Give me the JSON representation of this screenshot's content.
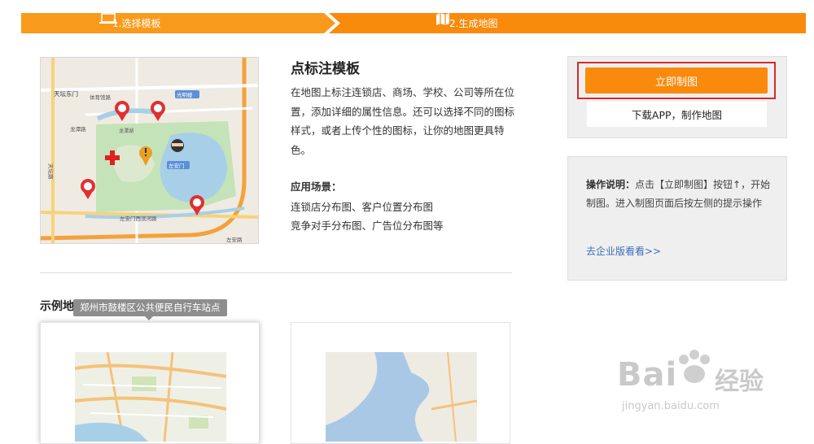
{
  "steps": [
    {
      "label": "1.选择模板",
      "icon": "laptop-icon"
    },
    {
      "label": "2.生成地图",
      "icon": "map-icon"
    }
  ],
  "colors": {
    "accent": "#fa8a0c",
    "highlight": "#d62b2b",
    "link": "#3b6fb6"
  },
  "template": {
    "title": "点标注模板",
    "description": "在地图上标注连锁店、商场、学校、公司等所在位置，添加详细的属性信息。还可以选择不同的图标样式，或者上传个性的图标，让你的地图更具特色。",
    "scenarios_title": "应用场景：",
    "scenarios": [
      "连锁店分布图、客户位置分布图",
      "竞争对手分布图、广告位分布图等"
    ],
    "preview_map_labels": [
      "天坛东门",
      "体育馆路",
      "光明楼",
      "龙潭路",
      "龙潭湖",
      "左安门",
      "左安门西滨河路",
      "左安路",
      "天坛路"
    ]
  },
  "examples": {
    "title": "示例地图",
    "tooltip": "郑州市鼓楼区公共便民自行车站点"
  },
  "actions": {
    "create_label": "立即制图",
    "app_label": "下载APP，制作地图"
  },
  "help": {
    "bold": "操作说明：",
    "text": "点击【立即制图】按钮↑，开始制图。进入制图页面后按左侧的提示操作",
    "link": "去企业版看看>>"
  },
  "watermark": {
    "main": "Bai",
    "cn": "经验",
    "sub": "jingyan.baidu.com"
  }
}
